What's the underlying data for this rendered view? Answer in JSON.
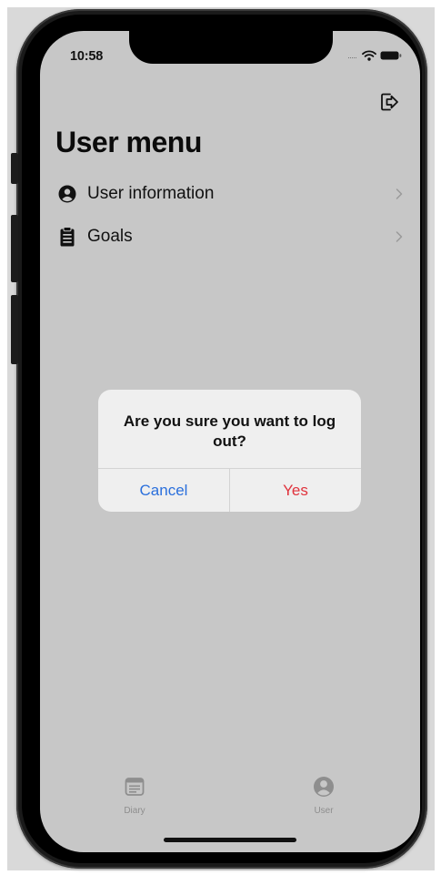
{
  "status_bar": {
    "time": "10:58"
  },
  "header": {
    "logout_icon": "logout-icon"
  },
  "page": {
    "title": "User menu"
  },
  "menu": {
    "items": [
      {
        "icon": "user-circle-icon",
        "label": "User information"
      },
      {
        "icon": "clipboard-icon",
        "label": "Goals"
      }
    ]
  },
  "dialog": {
    "message": "Are you sure you want to log out?",
    "cancel_label": "Cancel",
    "confirm_label": "Yes"
  },
  "tabbar": {
    "tabs": [
      {
        "icon": "diary-icon",
        "label": "Diary"
      },
      {
        "icon": "user-icon",
        "label": "User"
      }
    ]
  },
  "colors": {
    "screen_background": "#c7c7c7",
    "dialog_background": "#efefef",
    "cancel_text": "#2a6fdc",
    "confirm_text": "#e0323c",
    "tab_inactive": "#8e8e8e"
  }
}
